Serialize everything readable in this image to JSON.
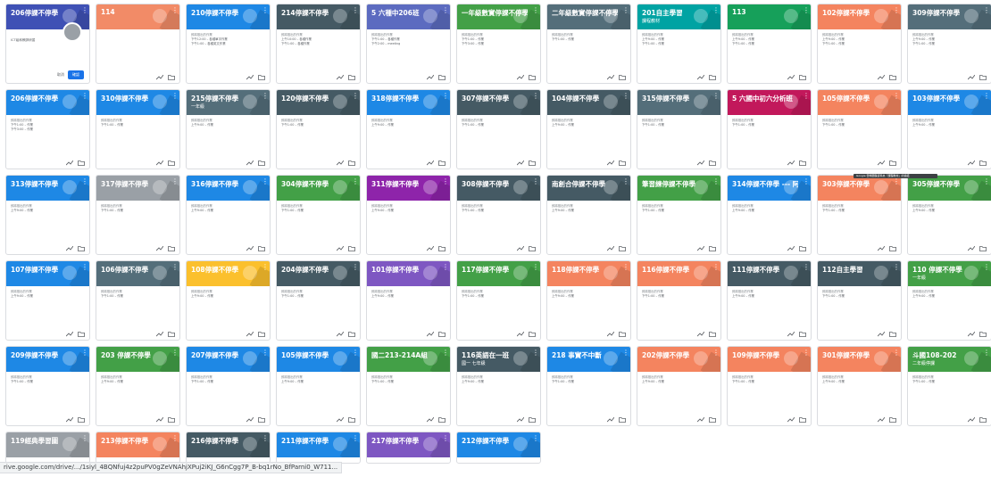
{
  "tooltip": "Google 雲端硬碟資料夾「課程教材」的連結",
  "status_url": "rive.google.com/drive/.../1siyl_4BQNfuj4z2puPV0gZeVNAhjXPuj2iKJ_G6nCgg7P_B-bq1rNo_BfParni0_W711...",
  "cards": [
    {
      "title": "206停課不停學",
      "color": "#3f51b5",
      "profile": true,
      "text": "ICT組和教師研習",
      "cancel": "取消",
      "ok": "確認"
    },
    {
      "title": "114",
      "color": "#f28b67",
      "lines": []
    },
    {
      "title": "210停課不停學",
      "color": "#1e88e5",
      "lines": [
        "即將推出的作業",
        "下午12:00 – 各種單字作業",
        "下午1:00 – 各種英文作業"
      ]
    },
    {
      "title": "214停課不停學",
      "color": "#455a64",
      "lines": [
        "即將推出的作業",
        "上午10:00 – 各種作業",
        "下午1:00 – 各種作業"
      ]
    },
    {
      "title": "5 六種中206班",
      "color": "#5c6bc0",
      "lines": [
        "即將推出的作業",
        "下午1:00 – 各種作業",
        "下午2:00 – meeting"
      ]
    },
    {
      "title": "一年級數實停課不停學",
      "color": "#43a047",
      "lines": [
        "即將推出的作業",
        "下午1:00 – 作業",
        "下午3:00 – 作業"
      ]
    },
    {
      "title": "二年級數實停課不停學",
      "color": "#546e7a",
      "lines": [
        "即將推出的作業",
        "下午1:00 – 作業"
      ]
    },
    {
      "title": "201自主學習",
      "subtitle": "課程教材",
      "color": "#00a3a3",
      "lines": [
        "即將推出的作業",
        "上午9:00 – 作業",
        "下午1:00 – 作業"
      ]
    },
    {
      "title": "113",
      "color": "#16a05a",
      "lines": [
        "即將推出的作業",
        "上午9:00 – 作業",
        "下午1:00 – 作業"
      ]
    },
    {
      "title": "102停課不停學",
      "color": "#f4845f",
      "lines": [
        "即將推出的作業",
        "上午9:00 – 作業",
        "下午1:00 – 作業"
      ]
    },
    {
      "title": "309停課不停學",
      "color": "#546e7a",
      "lines": [
        "即將推出的作業",
        "上午9:00 – 作業",
        "下午1:00 – 作業"
      ]
    },
    {
      "title": "206停課不停學",
      "color": "#1e88e5",
      "lines": [
        "即將推出的作業",
        "下午1:00 – 作業",
        "下午3:00 – 作業"
      ]
    },
    {
      "title": "310停課不停學",
      "color": "#1e88e5",
      "lines": [
        "即將推出的作業",
        "下午1:00 – 作業"
      ]
    },
    {
      "title": "215停課不停學",
      "subtitle": "一年級",
      "color": "#546e7a",
      "lines": [
        "即將推出的作業",
        "上午9:00 – 作業"
      ]
    },
    {
      "title": "120停課不停學",
      "color": "#455a64",
      "lines": [
        "即將推出的作業",
        "下午1:00 – 作業"
      ]
    },
    {
      "title": "318停課不停學",
      "color": "#1e88e5",
      "lines": [
        "即將推出的作業",
        "上午9:00 – 作業"
      ]
    },
    {
      "title": "307停課不停學",
      "color": "#455a64",
      "lines": [
        "即將推出的作業",
        "下午1:00 – 作業"
      ]
    },
    {
      "title": "104停課不停學",
      "color": "#455a64",
      "lines": [
        "即將推出的作業",
        "上午9:00 – 作業"
      ]
    },
    {
      "title": "315停課不停學",
      "color": "#546e7a",
      "lines": [
        "即將推出的作業",
        "下午1:00 – 作業"
      ]
    },
    {
      "title": "5 六國中初六分析班",
      "color": "#c2185b",
      "lines": [
        "即將推出的作業",
        "下午1:00 – 作業"
      ]
    },
    {
      "title": "105停課不停學",
      "color": "#f4845f",
      "lines": [
        "即將推出的作業",
        "下午1:00 – 作業"
      ]
    },
    {
      "title": "103停課不停學",
      "color": "#1e88e5",
      "lines": [
        "即將推出的作業",
        "上午9:00 – 作業"
      ]
    },
    {
      "title": "313停課不停學",
      "color": "#1e88e5",
      "lines": [
        "即將推出的作業",
        "上午9:00 – 作業"
      ]
    },
    {
      "title": "317停課不停學",
      "color": "#9aa0a6",
      "lines": [
        "即將推出的作業",
        "下午1:00 – 作業"
      ]
    },
    {
      "title": "316停課不停學",
      "color": "#1e88e5",
      "lines": [
        "即將推出的作業",
        "上午9:00 – 作業"
      ]
    },
    {
      "title": "304停課不停學",
      "color": "#43a047",
      "lines": [
        "即將推出的作業",
        "下午1:00 – 作業"
      ]
    },
    {
      "title": "311停課不停學",
      "color": "#8e24aa",
      "lines": [
        "即將推出的作業",
        "上午9:00 – 作業"
      ]
    },
    {
      "title": "308停課不停學",
      "color": "#455a64",
      "lines": [
        "即將推出的作業",
        "下午1:00 – 作業"
      ]
    },
    {
      "title": "南創合停課不停學",
      "color": "#455a64",
      "lines": [
        "即將推出的作業",
        "上午9:00 – 作業"
      ]
    },
    {
      "title": "筆習練停課不停學",
      "color": "#43a047",
      "lines": [
        "即將推出的作業",
        "下午1:00 – 作業"
      ]
    },
    {
      "title": "314停課不停學 --- 阿",
      "color": "#1e88e5",
      "lines": [
        "即將推出的作業",
        "上午9:00 – 作業"
      ]
    },
    {
      "title": "303停課不停學",
      "color": "#f4845f",
      "lines": [
        "即將推出的作業",
        "下午1:00 – 作業"
      ]
    },
    {
      "title": "305停課不停學",
      "color": "#43a047",
      "lines": [
        "即將推出的作業",
        "上午9:00 – 作業"
      ]
    },
    {
      "title": "107停課不停學",
      "color": "#1e88e5",
      "lines": [
        "即將推出的作業",
        "上午9:00 – 作業"
      ]
    },
    {
      "title": "106停課不停學",
      "color": "#546e7a",
      "lines": [
        "即將推出的作業",
        "下午1:00 – 作業"
      ]
    },
    {
      "title": "108停課不停學",
      "color": "#fbc02d",
      "lines": [
        "即將推出的作業",
        "上午9:00 – 作業"
      ]
    },
    {
      "title": "204停課不停學",
      "color": "#455a64",
      "lines": [
        "即將推出的作業",
        "下午1:00 – 作業"
      ]
    },
    {
      "title": "101停課不停學",
      "color": "#7e57c2",
      "lines": [
        "即將推出的作業",
        "上午9:00 – 作業"
      ]
    },
    {
      "title": "117停課不停學",
      "color": "#43a047",
      "lines": [
        "即將推出的作業",
        "下午1:00 – 作業"
      ]
    },
    {
      "title": "118停課不停學",
      "color": "#f4845f",
      "lines": [
        "即將推出的作業",
        "上午9:00 – 作業"
      ]
    },
    {
      "title": "116停課不停學",
      "color": "#f4845f",
      "lines": [
        "即將推出的作業",
        "下午1:00 – 作業"
      ]
    },
    {
      "title": "111停課不停學",
      "color": "#455a64",
      "lines": [
        "即將推出的作業",
        "上午9:00 – 作業"
      ]
    },
    {
      "title": "112自主學習",
      "color": "#455a64",
      "lines": [
        "即將推出的作業",
        "下午1:00 – 作業"
      ]
    },
    {
      "title": "110 停課不停學",
      "subtitle": "一年級",
      "color": "#43a047",
      "lines": [
        "即將推出的作業",
        "上午9:00 – 作業"
      ]
    },
    {
      "title": "209停課不停學",
      "color": "#1e88e5",
      "lines": [
        "即將推出的作業",
        "下午1:00 – 作業"
      ]
    },
    {
      "title": "203 停課不停學",
      "color": "#43a047",
      "lines": [
        "即將推出的作業",
        "上午9:00 – 作業"
      ]
    },
    {
      "title": "207停課不停學",
      "color": "#1e88e5",
      "lines": [
        "即將推出的作業",
        "下午1:00 – 作業"
      ]
    },
    {
      "title": "105停課不停學",
      "color": "#1e88e5",
      "lines": [
        "即將推出的作業",
        "上午9:00 – 作業"
      ]
    },
    {
      "title": "國二213-214A組",
      "color": "#43a047",
      "lines": [
        "即將推出的作業",
        "下午1:00 – 作業"
      ]
    },
    {
      "title": "116英語在一班",
      "subtitle": "國一 七年級",
      "color": "#455a64",
      "lines": [
        "即將推出的作業",
        "上午9:00 – 作業"
      ]
    },
    {
      "title": "218 事實不中斷",
      "color": "#1e88e5",
      "lines": [
        "即將推出的作業",
        "下午1:00 – 作業"
      ]
    },
    {
      "title": "202停課不停學",
      "color": "#f4845f",
      "lines": [
        "即將推出的作業",
        "上午9:00 – 作業"
      ]
    },
    {
      "title": "109停課不停學",
      "color": "#f4845f",
      "lines": [
        "即將推出的作業",
        "下午1:00 – 作業"
      ]
    },
    {
      "title": "301停課不停學",
      "color": "#f4845f",
      "lines": [
        "即將推出的作業",
        "上午9:00 – 作業"
      ]
    },
    {
      "title": "斗國108-202",
      "subtitle": "二年級停課",
      "color": "#43a047",
      "lines": [
        "即將推出的作業",
        "下午1:00 – 作業"
      ]
    },
    {
      "title": "119經典學習圖",
      "color": "#9aa0a6",
      "short": true
    },
    {
      "title": "213停課不停學",
      "color": "#f4845f",
      "short": true
    },
    {
      "title": "216停課不停學",
      "color": "#455a64",
      "short": true
    },
    {
      "title": "211停課不停學",
      "color": "#1e88e5",
      "short": true
    },
    {
      "title": "217停課不停學",
      "color": "#7e57c2",
      "short": true
    },
    {
      "title": "212停課不停學",
      "color": "#1e88e5",
      "short": true
    }
  ]
}
